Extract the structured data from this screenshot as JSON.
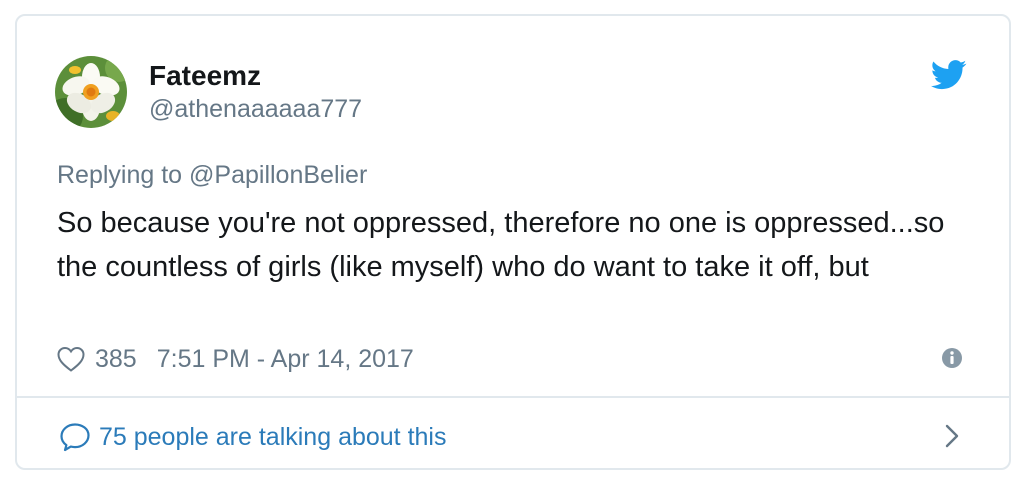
{
  "author": {
    "display_name": "Fateemz",
    "handle": "@athenaaaaaa777",
    "avatar_icon": "daffodil-avatar"
  },
  "reply": {
    "replying_to_prefix": "Replying to",
    "replying_to_handle": "@PapillonBelier"
  },
  "tweet": {
    "text": "So because you're not oppressed, therefore no one is oppressed...so the countless of girls (like myself) who do want to take it off, but"
  },
  "meta": {
    "likes": "385",
    "timestamp": "7:51 PM - Apr 14, 2017"
  },
  "footer": {
    "talking_text": "75 people are talking about this"
  },
  "colors": {
    "twitter_blue": "#1da1f2",
    "link_blue": "#2b7bb9",
    "secondary_text": "#657786",
    "border": "#e1e8ed"
  }
}
